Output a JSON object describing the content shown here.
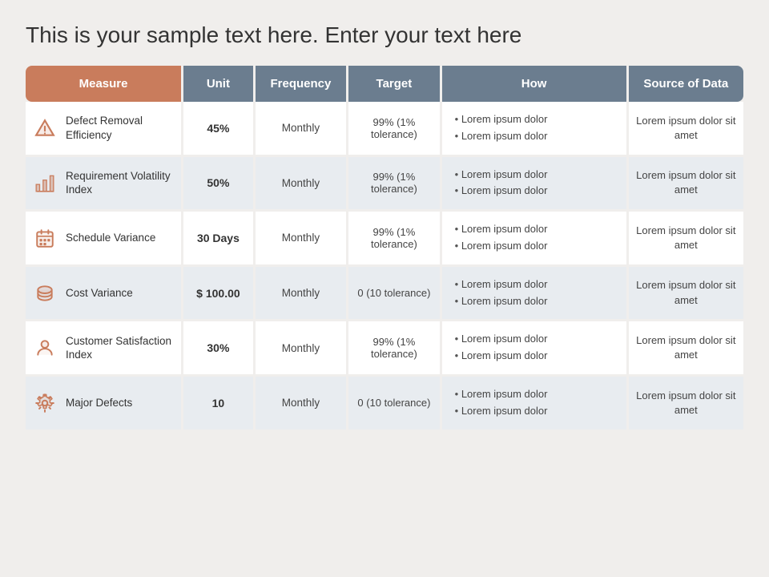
{
  "page": {
    "title": "This is your sample text here. Enter your text here"
  },
  "header": {
    "columns": [
      "Measure",
      "Unit",
      "Frequency",
      "Target",
      "How",
      "Source of Data"
    ]
  },
  "rows": [
    {
      "id": "defect-removal",
      "icon": "warning",
      "measure": "Defect Removal Efficiency",
      "unit": "45%",
      "frequency": "Monthly",
      "target": "99% (1% tolerance)",
      "how": [
        "Lorem ipsum dolor",
        "Lorem ipsum dolor"
      ],
      "source": "Lorem ipsum dolor sit amet"
    },
    {
      "id": "requirement-volatility",
      "icon": "chart",
      "measure": "Requirement Volatility Index",
      "unit": "50%",
      "frequency": "Monthly",
      "target": "99% (1% tolerance)",
      "how": [
        "Lorem ipsum dolor",
        "Lorem ipsum dolor"
      ],
      "source": "Lorem ipsum dolor sit amet"
    },
    {
      "id": "schedule-variance",
      "icon": "calendar",
      "measure": "Schedule Variance",
      "unit": "30 Days",
      "frequency": "Monthly",
      "target": "99% (1% tolerance)",
      "how": [
        "Lorem ipsum dolor",
        "Lorem ipsum dolor"
      ],
      "source": "Lorem ipsum dolor sit amet"
    },
    {
      "id": "cost-variance",
      "icon": "money",
      "measure": "Cost Variance",
      "unit": "$ 100.00",
      "frequency": "Monthly",
      "target": "0 (10 tolerance)",
      "how": [
        "Lorem ipsum dolor",
        "Lorem ipsum dolor"
      ],
      "source": "Lorem ipsum dolor sit amet"
    },
    {
      "id": "customer-satisfaction",
      "icon": "user",
      "measure": "Customer Satisfaction Index",
      "unit": "30%",
      "frequency": "Monthly",
      "target": "99% (1% tolerance)",
      "how": [
        "Lorem ipsum dolor",
        "Lorem ipsum dolor"
      ],
      "source": "Lorem ipsum dolor sit amet"
    },
    {
      "id": "major-defects",
      "icon": "gear",
      "measure": "Major Defects",
      "unit": "10",
      "frequency": "Monthly",
      "target": "0 (10 tolerance)",
      "how": [
        "Lorem ipsum dolor",
        "Lorem ipsum dolor"
      ],
      "source": "Lorem ipsum dolor sit amet"
    }
  ]
}
